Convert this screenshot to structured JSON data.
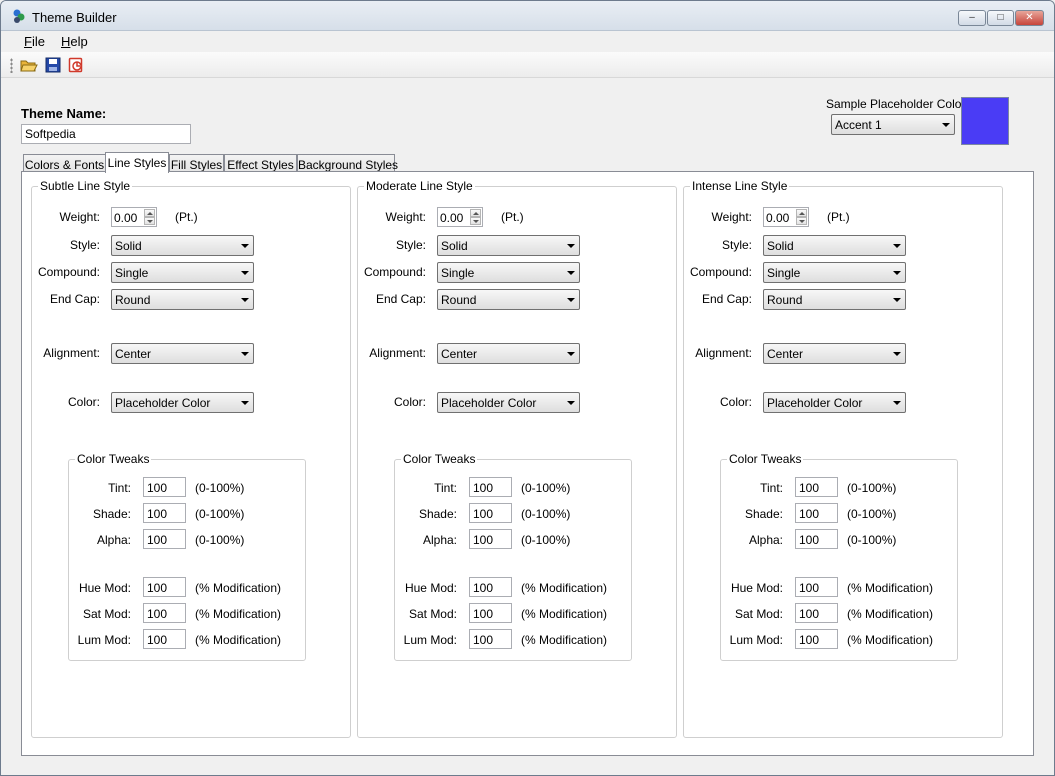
{
  "window": {
    "title": "Theme Builder"
  },
  "menu": {
    "file": "File",
    "help": "Help"
  },
  "toolbar": {
    "open": "open-folder-icon",
    "save": "save-disk-icon",
    "export": "export-icon"
  },
  "theme": {
    "name_label": "Theme Name:",
    "name_value": "Softpedia"
  },
  "sample": {
    "label": "Sample Placeholder Color:",
    "value": "Accent 1",
    "swatch_color": "#4a3cf5"
  },
  "tabs": [
    "Colors & Fonts",
    "Line Styles",
    "Fill Styles",
    "Effect Styles",
    "Background Styles"
  ],
  "active_tab": "Line Styles",
  "labels": {
    "weight": "Weight:",
    "unit": "(Pt.)",
    "style": "Style:",
    "compound": "Compound:",
    "endcap": "End Cap:",
    "alignment": "Alignment:",
    "color": "Color:",
    "tweaks": "Color Tweaks",
    "tint": "Tint:",
    "shade": "Shade:",
    "alpha": "Alpha:",
    "range": "(0-100%)",
    "huemod": "Hue Mod:",
    "satmod": "Sat Mod:",
    "lummod": "Lum Mod:",
    "mod": "(% Modification)"
  },
  "groups": [
    {
      "title": "Subtle Line Style",
      "weight": "0.00",
      "style": "Solid",
      "compound": "Single",
      "endcap": "Round",
      "alignment": "Center",
      "color": "Placeholder Color",
      "tint": "100",
      "shade": "100",
      "alpha": "100",
      "huemod": "100",
      "satmod": "100",
      "lummod": "100"
    },
    {
      "title": "Moderate Line Style",
      "weight": "0.00",
      "style": "Solid",
      "compound": "Single",
      "endcap": "Round",
      "alignment": "Center",
      "color": "Placeholder Color",
      "tint": "100",
      "shade": "100",
      "alpha": "100",
      "huemod": "100",
      "satmod": "100",
      "lummod": "100"
    },
    {
      "title": "Intense Line Style",
      "weight": "0.00",
      "style": "Solid",
      "compound": "Single",
      "endcap": "Round",
      "alignment": "Center",
      "color": "Placeholder Color",
      "tint": "100",
      "shade": "100",
      "alpha": "100",
      "huemod": "100",
      "satmod": "100",
      "lummod": "100"
    }
  ]
}
